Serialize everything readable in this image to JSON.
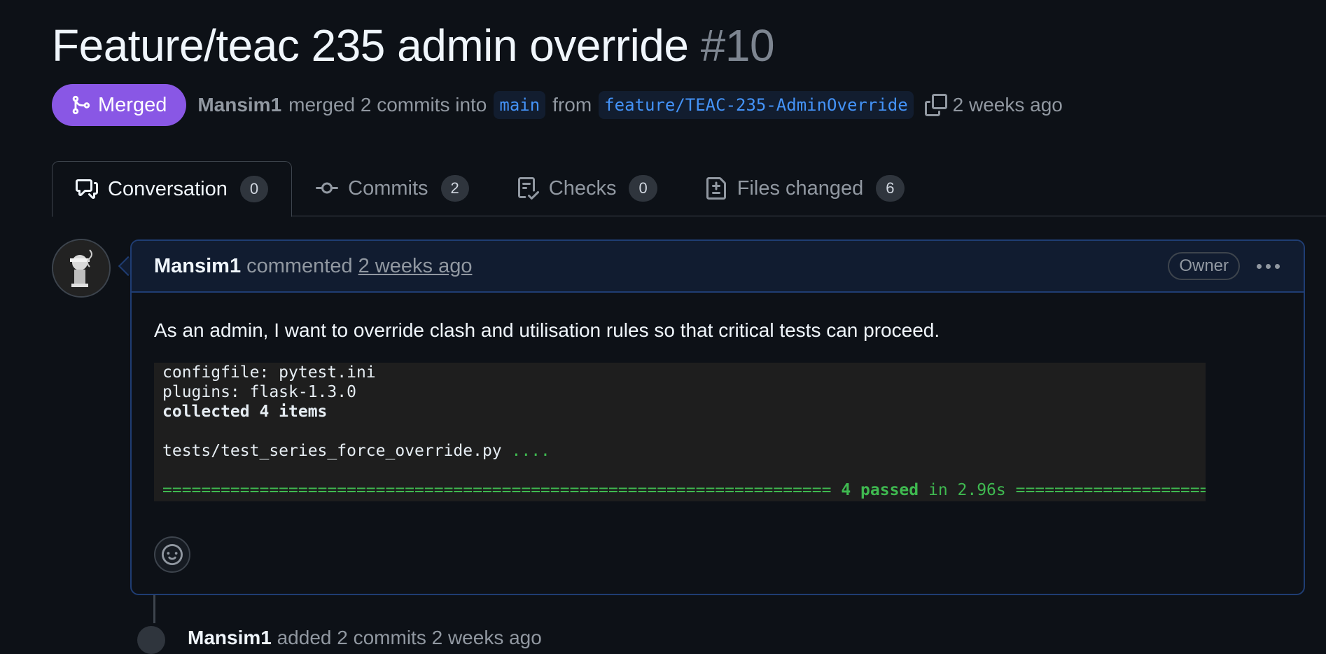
{
  "pr": {
    "title": "Feature/teac 235 admin override",
    "number": "#10",
    "state": "Merged",
    "author": "Mansim1",
    "merged_text": "merged 2 commits into",
    "base_branch": "main",
    "from_text": "from",
    "head_branch": "feature/TEAC-235-AdminOverride",
    "time": "2 weeks ago",
    "merged_color": "#8957e5"
  },
  "tabs": [
    {
      "label": "Conversation",
      "count": "0",
      "icon": "comment-discussion-icon",
      "active": true
    },
    {
      "label": "Commits",
      "count": "2",
      "icon": "git-commit-icon"
    },
    {
      "label": "Checks",
      "count": "0",
      "icon": "checklist-icon"
    },
    {
      "label": "Files changed",
      "count": "6",
      "icon": "file-diff-icon"
    }
  ],
  "comment": {
    "author": "Mansim1",
    "action": "commented",
    "time": "2 weeks ago",
    "role": "Owner",
    "text": "As an admin, I want to override clash and utilisation rules so that critical tests can proceed.",
    "code": {
      "line1": "configfile: pytest.ini",
      "line2": "plugins: flask-1.3.0",
      "line3": "collected 4 items",
      "line5_file": "tests/test_series_force_override.py",
      "line5_dots": "....",
      "rule_left": "=====================================================================",
      "passed": "4 passed",
      "in_time": "in 2.96s",
      "rule_right": "====================="
    }
  },
  "timeline": {
    "author": "Mansim1",
    "text": "added 2 commits 2 weeks ago"
  }
}
